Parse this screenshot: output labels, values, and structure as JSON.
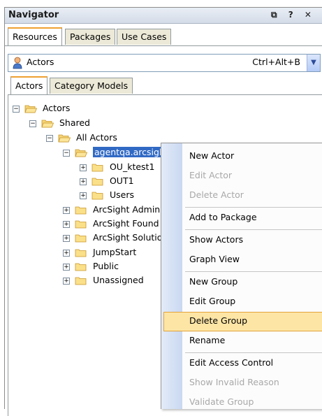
{
  "navigator": {
    "title": "Navigator",
    "icons": "⧉ ? ✕"
  },
  "tabs": [
    "Resources",
    "Packages",
    "Use Cases"
  ],
  "chooser": {
    "label": "Actors",
    "shortcut": "Ctrl+Alt+B"
  },
  "subtabs": [
    "Actors",
    "Category Models"
  ],
  "tree": {
    "root": "Actors",
    "shared": "Shared",
    "all_actors": "All Actors",
    "selected": "agentqa.arcsight.COM",
    "children": [
      "OU_ktest1",
      "OUT1",
      "Users"
    ],
    "siblings": [
      "ArcSight Admin",
      "ArcSight Found",
      "ArcSight Solutio",
      "JumpStart",
      "Public",
      "Unassigned"
    ]
  },
  "menu": {
    "items": [
      {
        "label": "New Actor",
        "enabled": true
      },
      {
        "label": "Edit Actor",
        "enabled": false
      },
      {
        "label": "Delete Actor",
        "enabled": false
      },
      {
        "label": "Add to Package",
        "enabled": true
      },
      {
        "label": "Show Actors",
        "enabled": true
      },
      {
        "label": "Graph View",
        "enabled": true
      },
      {
        "label": "New Group",
        "enabled": true
      },
      {
        "label": "Edit Group",
        "enabled": true
      },
      {
        "label": "Delete Group",
        "enabled": true
      },
      {
        "label": "Rename",
        "enabled": true
      },
      {
        "label": "Edit Access Control",
        "enabled": true
      },
      {
        "label": "Show Invalid Reason",
        "enabled": false
      },
      {
        "label": "Validate Group",
        "enabled": false
      }
    ],
    "highlighted": "Delete Group"
  },
  "colors": {
    "selection": "#316ac5",
    "highlight": "#fde5a6",
    "tab_accent": "#f0a030"
  }
}
